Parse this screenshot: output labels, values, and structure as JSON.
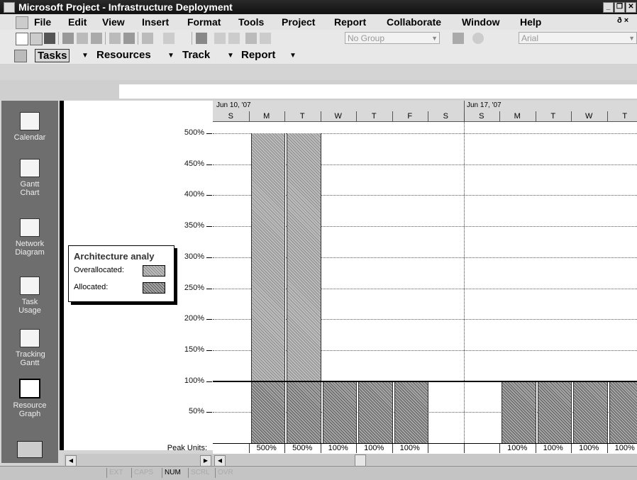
{
  "window": {
    "title": "Microsoft Project - Infrastructure Deployment",
    "controls": [
      "_",
      "❐",
      "✕"
    ]
  },
  "menu": [
    "File",
    "Edit",
    "View",
    "Insert",
    "Format",
    "Tools",
    "Project",
    "Report",
    "Collaborate",
    "Window",
    "Help"
  ],
  "menu_right": "ð ×",
  "toolbar": {
    "group_combo": "No Group",
    "font_combo": "Arial"
  },
  "toolbar2": {
    "items": [
      "Tasks",
      "Resources",
      "Track",
      "Report"
    ]
  },
  "viewbar": {
    "items": [
      "Calendar",
      "Gantt Chart",
      "Network Diagram",
      "Task Usage",
      "Tracking Gantt",
      "Resource Graph"
    ],
    "active": "Resource Graph"
  },
  "legend": {
    "title": "Architecture analy",
    "overallocated": "Overallocated:",
    "allocated": "Allocated:"
  },
  "timescale": {
    "weeks": [
      "Jun 10, '07",
      "Jun 17, '07"
    ],
    "days": [
      "S",
      "M",
      "T",
      "W",
      "T",
      "F",
      "S",
      "S",
      "M",
      "T",
      "W",
      "T"
    ]
  },
  "chart_data": {
    "type": "bar",
    "title": "Architecture analy",
    "ylabel": "",
    "yticks": [
      "500%",
      "450%",
      "400%",
      "350%",
      "300%",
      "250%",
      "200%",
      "150%",
      "100%",
      "50%"
    ],
    "ylim": [
      0,
      500
    ],
    "max_units": 100,
    "categories": [
      "S",
      "M",
      "T",
      "W",
      "T",
      "F",
      "S",
      "S",
      "M",
      "T",
      "W",
      "T"
    ],
    "series": [
      {
        "name": "Allocated",
        "values": [
          0,
          100,
          100,
          100,
          100,
          100,
          0,
          0,
          100,
          100,
          100,
          100
        ]
      },
      {
        "name": "Overallocated",
        "values": [
          0,
          400,
          400,
          0,
          0,
          0,
          0,
          0,
          0,
          0,
          0,
          0
        ]
      }
    ],
    "peak_units": [
      "",
      "500%",
      "500%",
      "100%",
      "100%",
      "100%",
      "",
      "",
      "100%",
      "100%",
      "100%",
      "100%"
    ],
    "peak_units_label": "Peak Units:"
  },
  "status": {
    "items": [
      "EXT",
      "CAPS",
      "NUM",
      "SCRL",
      "OVR"
    ]
  }
}
